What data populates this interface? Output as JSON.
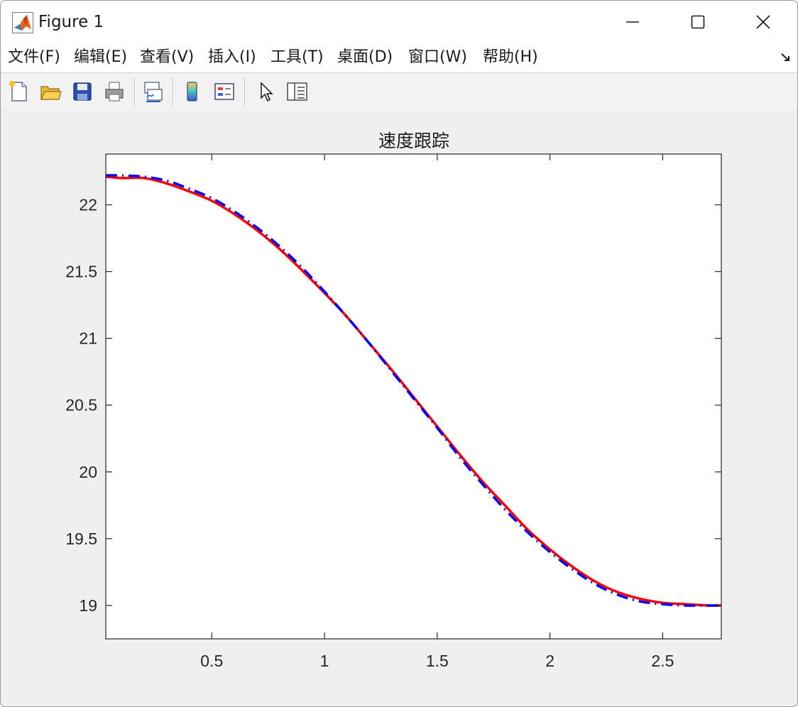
{
  "window": {
    "title": "Figure 1",
    "app_icon": "matlab-logo-icon",
    "controls": [
      "minimize-icon",
      "maximize-icon",
      "close-icon"
    ]
  },
  "menu": {
    "items": [
      {
        "label": "文件(F)"
      },
      {
        "label": "编辑(E)"
      },
      {
        "label": "查看(V)"
      },
      {
        "label": "插入(I)"
      },
      {
        "label": "工具(T)"
      },
      {
        "label": "桌面(D)"
      },
      {
        "label": "窗口(W)"
      },
      {
        "label": "帮助(H)"
      }
    ],
    "dock_icon": "dock-arrow-icon"
  },
  "toolbar": {
    "buttons": [
      {
        "icon": "new-figure-icon"
      },
      {
        "icon": "open-file-icon"
      },
      {
        "icon": "save-icon"
      },
      {
        "icon": "print-icon"
      },
      {
        "icon": "link-plot-icon"
      },
      {
        "icon": "insert-colorbar-icon"
      },
      {
        "icon": "insert-legend-icon"
      },
      {
        "icon": "edit-plot-pointer-icon"
      },
      {
        "icon": "property-inspector-icon"
      }
    ]
  },
  "chart_data": {
    "type": "line",
    "title": "速度跟踪",
    "xlabel": "",
    "ylabel": "",
    "xlim": [
      0.03,
      2.76
    ],
    "ylim": [
      18.75,
      22.38
    ],
    "xticks": [
      0.5,
      1,
      1.5,
      2,
      2.5
    ],
    "xtick_labels": [
      "0.5",
      "1",
      "1.5",
      "2",
      "2.5"
    ],
    "yticks": [
      19,
      19.5,
      20,
      20.5,
      21,
      21.5,
      22
    ],
    "ytick_labels": [
      "19",
      "19.5",
      "20",
      "20.5",
      "21",
      "21.5",
      "22"
    ],
    "grid": false,
    "legend": false,
    "series": [
      {
        "color": "#ff0000",
        "style": "solid",
        "x": [
          0.03,
          0.1,
          0.2,
          0.3,
          0.4,
          0.5,
          0.6,
          0.7,
          0.8,
          0.9,
          1.0,
          1.1,
          1.2,
          1.3,
          1.4,
          1.5,
          1.6,
          1.7,
          1.8,
          1.9,
          2.0,
          2.1,
          2.2,
          2.3,
          2.4,
          2.5,
          2.6,
          2.7,
          2.76
        ],
        "y": [
          22.21,
          22.2,
          22.2,
          22.16,
          22.1,
          22.03,
          21.93,
          21.81,
          21.67,
          21.51,
          21.34,
          21.16,
          20.96,
          20.76,
          20.55,
          20.34,
          20.13,
          19.93,
          19.75,
          19.57,
          19.42,
          19.29,
          19.18,
          19.1,
          19.05,
          19.02,
          19.01,
          19.0,
          19.0
        ]
      },
      {
        "color": "#0000ff",
        "style": "dash-dot",
        "x": [
          0.03,
          0.1,
          0.2,
          0.3,
          0.4,
          0.5,
          0.6,
          0.7,
          0.8,
          0.9,
          1.0,
          1.1,
          1.2,
          1.3,
          1.4,
          1.5,
          1.6,
          1.7,
          1.8,
          1.9,
          2.0,
          2.1,
          2.2,
          2.3,
          2.4,
          2.5,
          2.6,
          2.7,
          2.76
        ],
        "y": [
          22.22,
          22.22,
          22.21,
          22.18,
          22.12,
          22.05,
          21.95,
          21.83,
          21.69,
          21.53,
          21.35,
          21.16,
          20.96,
          20.75,
          20.54,
          20.33,
          20.11,
          19.91,
          19.72,
          19.55,
          19.4,
          19.27,
          19.16,
          19.08,
          19.03,
          19.01,
          19.0,
          19.0,
          19.0
        ]
      }
    ]
  }
}
